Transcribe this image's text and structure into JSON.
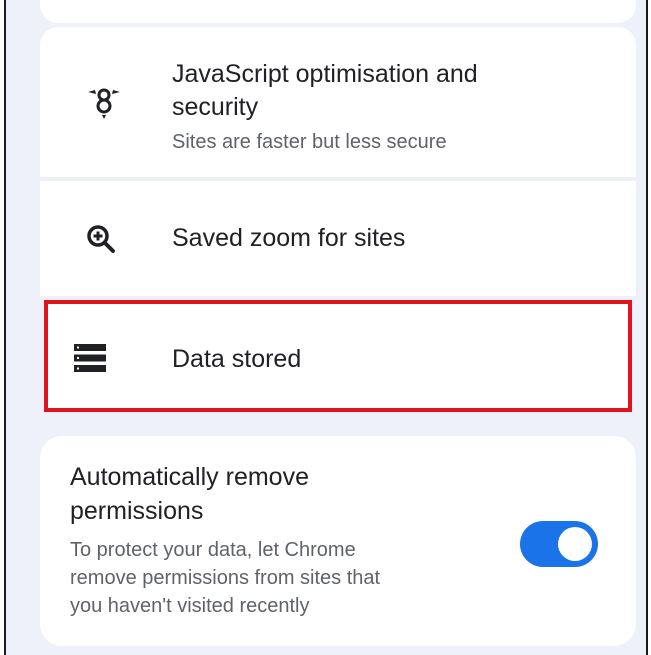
{
  "settings": {
    "javascript": {
      "title_line1": "JavaScript optimisation and",
      "title_line2": "security",
      "subtitle": "Sites are faster but less secure",
      "icon": "v8-engine-icon"
    },
    "zoom": {
      "title": "Saved zoom for sites",
      "icon": "zoom-in-icon"
    },
    "data_stored": {
      "title": "Data stored",
      "icon": "storage-icon",
      "highlight_color": "#e0141e"
    },
    "auto_remove": {
      "title_line1": "Automatically remove",
      "title_line2": "permissions",
      "desc_line1": "To protect your data, let Chrome",
      "desc_line2": "remove permissions from sites that",
      "desc_line3": "you haven't visited recently",
      "toggle_on": true,
      "toggle_color": "#1a73e8"
    }
  },
  "colors": {
    "background": "#eef1fa",
    "card": "#ffffff",
    "text_primary": "#202124",
    "text_secondary": "#5f6368"
  }
}
